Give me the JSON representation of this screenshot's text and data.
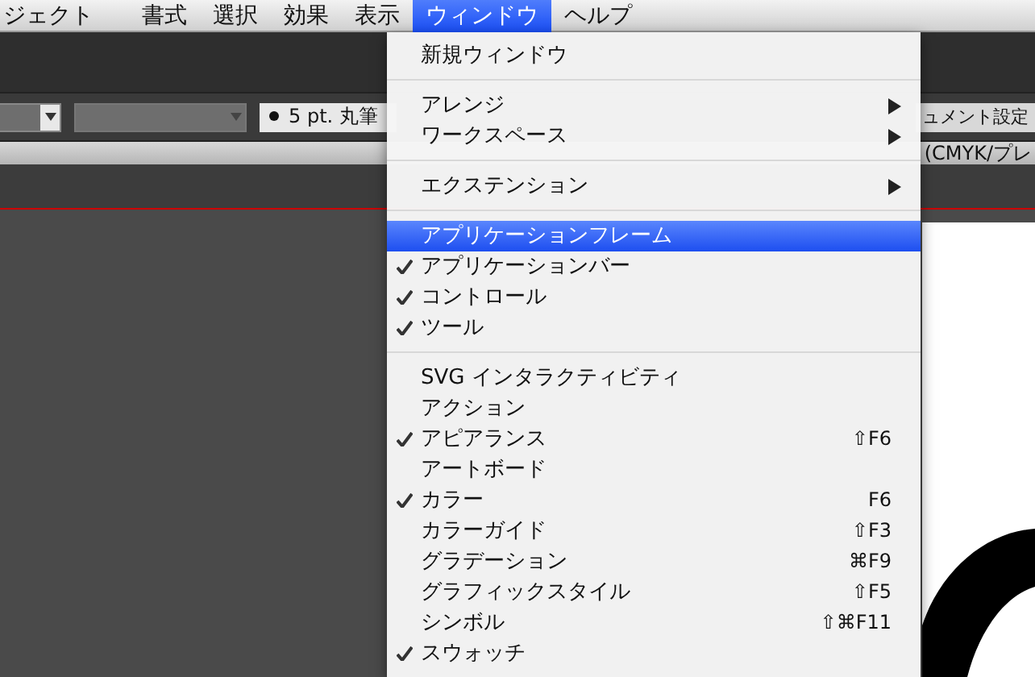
{
  "menubar": [
    {
      "label": "ジェクト",
      "selected": false
    },
    {
      "label": "書式",
      "selected": false
    },
    {
      "label": "選択",
      "selected": false
    },
    {
      "label": "効果",
      "selected": false
    },
    {
      "label": "表示",
      "selected": false
    },
    {
      "label": "ウィンドウ",
      "selected": true
    },
    {
      "label": "ヘルプ",
      "selected": false
    }
  ],
  "control_bar": {
    "dropdowns": [
      {
        "enabled": true
      },
      {
        "enabled": false
      }
    ],
    "brush_field": {
      "value": "5 pt. 丸筆"
    },
    "document_setup_button": "ュメント設定"
  },
  "document_tab": {
    "label": "(CMYK/プレ"
  },
  "menu": {
    "items": [
      {
        "kind": "item",
        "label": "新規ウィンドウ",
        "checked": false,
        "selected": false
      },
      {
        "kind": "separator"
      },
      {
        "kind": "item",
        "label": "アレンジ",
        "checked": false,
        "selected": false,
        "submenu": true
      },
      {
        "kind": "item",
        "label": "ワークスペース",
        "checked": false,
        "selected": false,
        "submenu": true
      },
      {
        "kind": "separator"
      },
      {
        "kind": "item",
        "label": "エクステンション",
        "checked": false,
        "selected": false,
        "submenu": true
      },
      {
        "kind": "separator"
      },
      {
        "kind": "item",
        "label": "アプリケーションフレーム",
        "checked": false,
        "selected": true
      },
      {
        "kind": "item",
        "label": "アプリケーションバー",
        "checked": true,
        "selected": false
      },
      {
        "kind": "item",
        "label": "コントロール",
        "checked": true,
        "selected": false
      },
      {
        "kind": "item",
        "label": "ツール",
        "checked": true,
        "selected": false
      },
      {
        "kind": "separator"
      },
      {
        "kind": "item",
        "label": "SVG インタラクティビティ",
        "checked": false,
        "selected": false
      },
      {
        "kind": "item",
        "label": "アクション",
        "checked": false,
        "selected": false
      },
      {
        "kind": "item",
        "label": "アピアランス",
        "checked": true,
        "selected": false,
        "shortcut": "⇧F6"
      },
      {
        "kind": "item",
        "label": "アートボード",
        "checked": false,
        "selected": false
      },
      {
        "kind": "item",
        "label": "カラー",
        "checked": true,
        "selected": false,
        "shortcut": "F6"
      },
      {
        "kind": "item",
        "label": "カラーガイド",
        "checked": false,
        "selected": false,
        "shortcut": "⇧F3"
      },
      {
        "kind": "item",
        "label": "グラデーション",
        "checked": false,
        "selected": false,
        "shortcut": "⌘F9"
      },
      {
        "kind": "item",
        "label": "グラフィックスタイル",
        "checked": false,
        "selected": false,
        "shortcut": "⇧F5"
      },
      {
        "kind": "item",
        "label": "シンボル",
        "checked": false,
        "selected": false,
        "shortcut": "⇧⌘F11"
      },
      {
        "kind": "item",
        "label": "スウォッチ",
        "checked": true,
        "selected": false
      }
    ]
  }
}
